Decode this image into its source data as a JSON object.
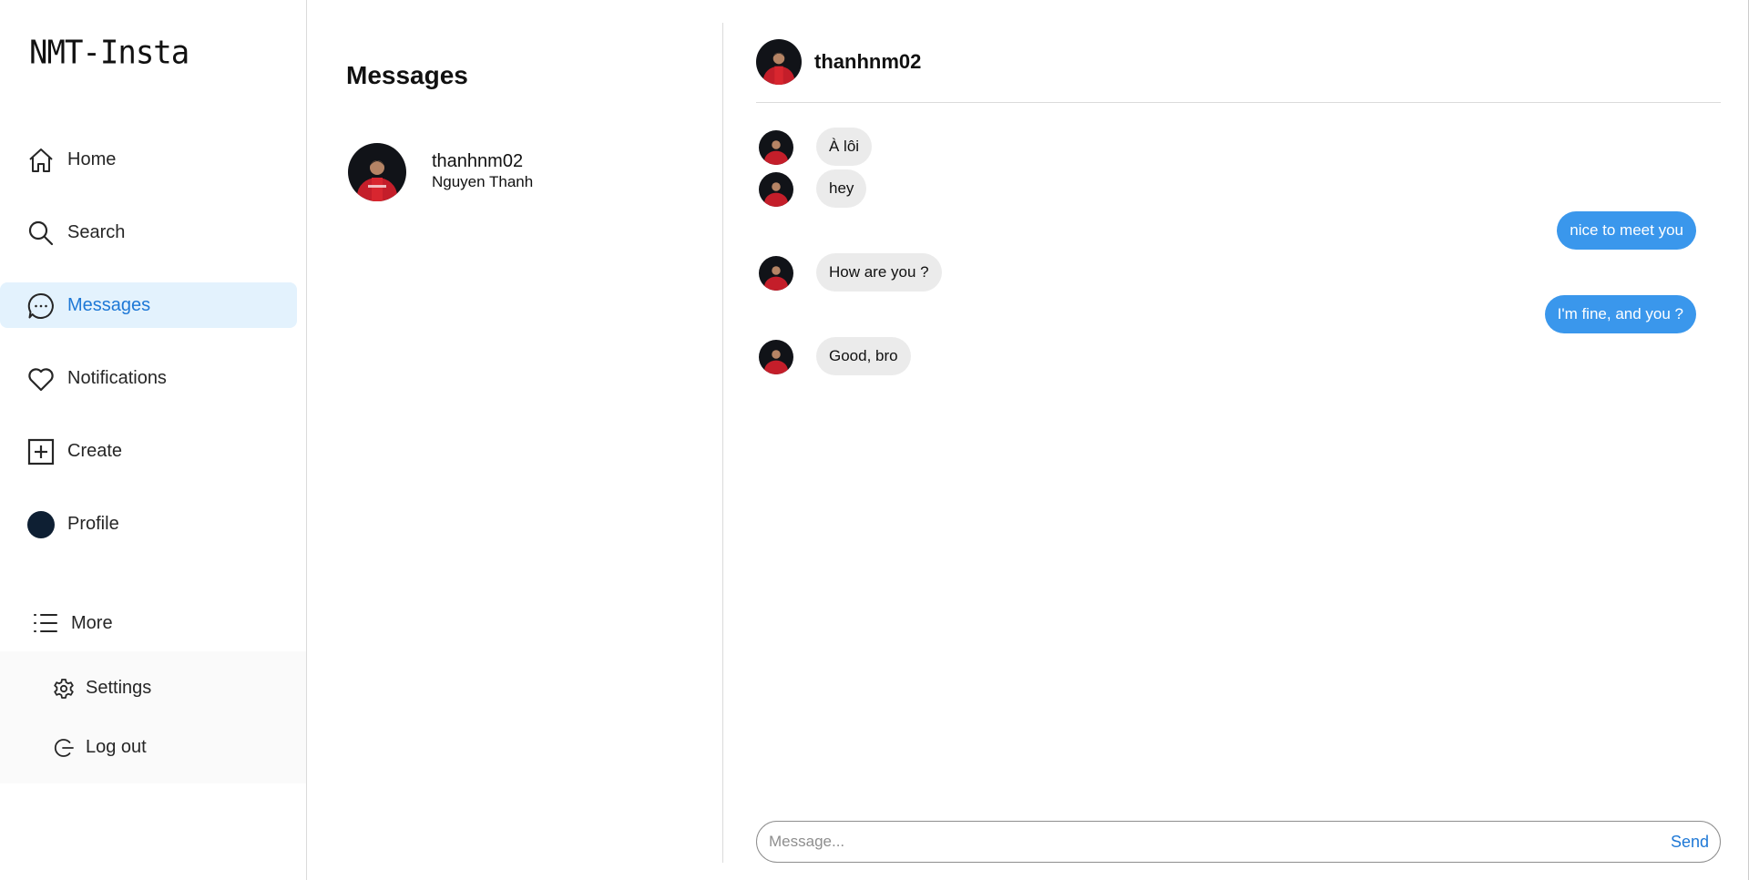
{
  "app": {
    "logo_text": "NMT-Insta"
  },
  "sidebar": {
    "items": [
      {
        "label": "Home",
        "icon": "home-icon"
      },
      {
        "label": "Search",
        "icon": "search-icon"
      },
      {
        "label": "Messages",
        "icon": "messages-icon",
        "active": true
      },
      {
        "label": "Notifications",
        "icon": "heart-icon"
      },
      {
        "label": "Create",
        "icon": "plus-square-icon"
      },
      {
        "label": "Profile",
        "icon": "profile-avatar"
      }
    ],
    "more": {
      "label": "More",
      "icon": "menu-list-icon"
    },
    "more_menu": [
      {
        "label": "Settings",
        "icon": "gear-icon"
      },
      {
        "label": "Log out",
        "icon": "logout-icon"
      }
    ],
    "active_color": "#1e78d6",
    "active_bg": "#e3f2fd"
  },
  "conversations": {
    "title": "Messages",
    "items": [
      {
        "username": "thanhnm02",
        "fullname": "Nguyen Thanh"
      }
    ]
  },
  "chat": {
    "header": {
      "username": "thanhnm02"
    },
    "messages": [
      {
        "direction": "in",
        "text": "À lôi"
      },
      {
        "direction": "in",
        "text": "hey"
      },
      {
        "direction": "out",
        "text": "nice to meet you"
      },
      {
        "direction": "in",
        "text": "How are you ?"
      },
      {
        "direction": "out",
        "text": "I'm fine, and you ?"
      },
      {
        "direction": "in",
        "text": "Good, bro"
      }
    ],
    "composer": {
      "placeholder": "Message...",
      "value": "",
      "send_label": "Send"
    },
    "outgoing_color": "#3a97ec",
    "incoming_color": "#ebebeb"
  }
}
